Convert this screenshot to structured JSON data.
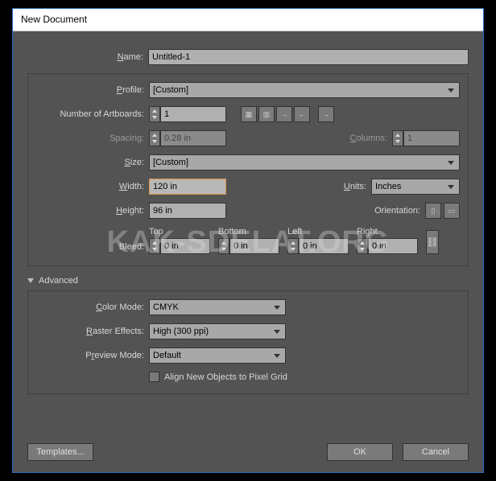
{
  "title": "New Document",
  "name": {
    "label": "Name:",
    "value": "Untitled-1"
  },
  "profile": {
    "label": "Profile:",
    "value": "[Custom]"
  },
  "artboards": {
    "label": "Number of Artboards:",
    "value": "1"
  },
  "spacing": {
    "label": "Spacing:",
    "value": "0.28 in"
  },
  "columns": {
    "label": "Columns:",
    "value": "1"
  },
  "size": {
    "label": "Size:",
    "value": "[Custom]"
  },
  "width": {
    "label": "Width:",
    "value": "120 in"
  },
  "units": {
    "label": "Units:",
    "value": "Inches"
  },
  "height": {
    "label": "Height:",
    "value": "96 in"
  },
  "orientation": {
    "label": "Orientation:"
  },
  "bleed": {
    "label": "Bleed:",
    "top": {
      "label": "Top",
      "value": "0 in"
    },
    "bottom": {
      "label": "Bottom",
      "value": "0 in"
    },
    "left": {
      "label": "Left",
      "value": "0 in"
    },
    "right": {
      "label": "Right",
      "value": "0 in"
    }
  },
  "advanced": {
    "header": "Advanced",
    "colorMode": {
      "label": "Color Mode:",
      "value": "CMYK"
    },
    "raster": {
      "label": "Raster Effects:",
      "value": "High (300 ppi)"
    },
    "preview": {
      "label": "Preview Mode:",
      "value": "Default"
    },
    "align": "Align New Objects to Pixel Grid"
  },
  "buttons": {
    "templates": "Templates...",
    "ok": "OK",
    "cancel": "Cancel"
  },
  "watermark": "KAK-SDELAT.ORG"
}
